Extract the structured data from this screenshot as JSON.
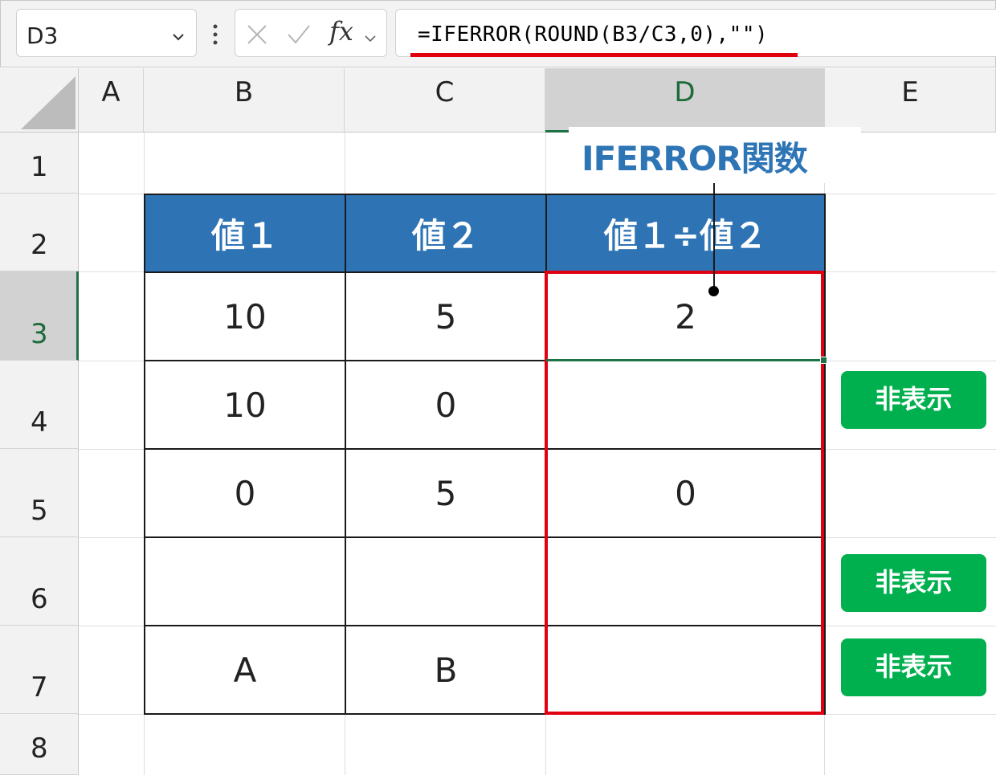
{
  "formula_bar": {
    "name_box": "D3",
    "fx_label": "fx",
    "formula": "=IFERROR(ROUND(B3/C3,0),\"\")"
  },
  "columns": [
    "A",
    "B",
    "C",
    "D",
    "E"
  ],
  "rows": [
    "1",
    "2",
    "3",
    "4",
    "5",
    "6",
    "7",
    "8"
  ],
  "active_cell": {
    "column": "D",
    "row": "3"
  },
  "table": {
    "headers": [
      "値１",
      "値２",
      "値１÷値２"
    ],
    "rows": [
      [
        "10",
        "5",
        "2"
      ],
      [
        "10",
        "0",
        ""
      ],
      [
        "0",
        "5",
        "0"
      ],
      [
        "",
        "",
        ""
      ],
      [
        "A",
        "B",
        ""
      ]
    ]
  },
  "annotation": {
    "label": "IFERROR関数"
  },
  "badges": [
    {
      "row": "4",
      "label": "非表示"
    },
    {
      "row": "6",
      "label": "非表示"
    },
    {
      "row": "7",
      "label": "非表示"
    }
  ],
  "colors": {
    "header_fill": "#2e74b5",
    "badge_fill": "#00b04f",
    "highlight_red": "#e00010",
    "annotation_blue": "#2e75b6",
    "excel_green": "#1e7145"
  }
}
